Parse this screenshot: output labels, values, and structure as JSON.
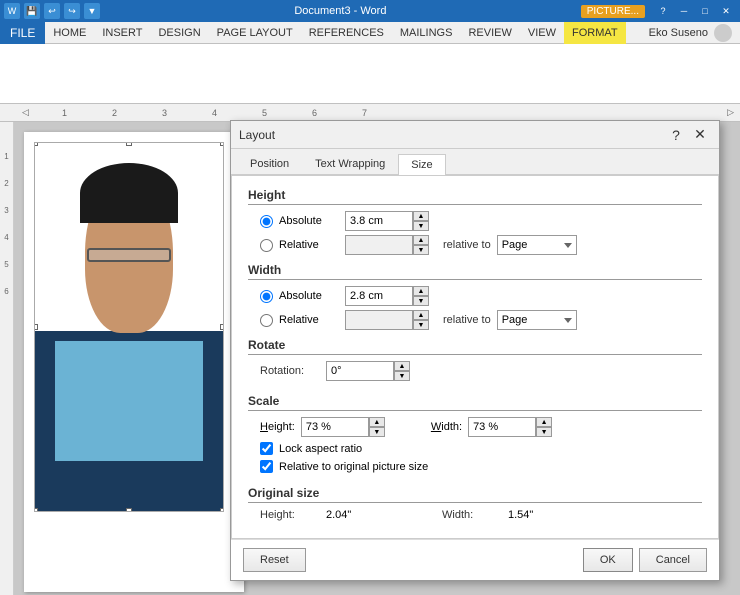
{
  "titlebar": {
    "title": "Document3 - Word",
    "picture_tab": "PICTURE...",
    "help": "?",
    "min": "🗕",
    "max": "🗖",
    "close": "✕"
  },
  "ribbon": {
    "file_label": "FILE",
    "tabs": [
      "HOME",
      "INSERT",
      "DESIGN",
      "PAGE LAYOUT",
      "REFERENCES",
      "MAILINGS",
      "REVIEW",
      "VIEW"
    ],
    "format_tab": "FORMAT",
    "user": "Eko Suseno"
  },
  "dialog": {
    "title": "Layout",
    "help": "?",
    "close": "✕",
    "tabs": [
      "Position",
      "Text Wrapping",
      "Size"
    ],
    "active_tab": "Size",
    "sections": {
      "height": {
        "label": "Height",
        "absolute_label": "Absolute",
        "absolute_value": "3.8 cm",
        "relative_label": "Relative",
        "relative_value": "",
        "relative_to_label": "relative to",
        "relative_to_value": "Page"
      },
      "width": {
        "label": "Width",
        "absolute_label": "Absolute",
        "absolute_value": "2.8 cm",
        "relative_label": "Relative",
        "relative_value": "",
        "relative_to_label": "relative to",
        "relative_to_value": "Page"
      },
      "rotate": {
        "label": "Rotate",
        "rotation_label": "Rotation:",
        "rotation_value": "0°"
      },
      "scale": {
        "label": "Scale",
        "height_label": "Height:",
        "height_value": "73 %",
        "width_label": "Width:",
        "width_value": "73 %",
        "lock_label": "Lock aspect ratio",
        "relative_label": "Relative to original picture size"
      },
      "original": {
        "label": "Original size",
        "height_label": "Height:",
        "height_value": "2.04\"",
        "width_label": "Width:",
        "width_value": "1.54\""
      }
    },
    "buttons": {
      "reset": "Reset",
      "ok": "OK",
      "cancel": "Cancel"
    }
  }
}
